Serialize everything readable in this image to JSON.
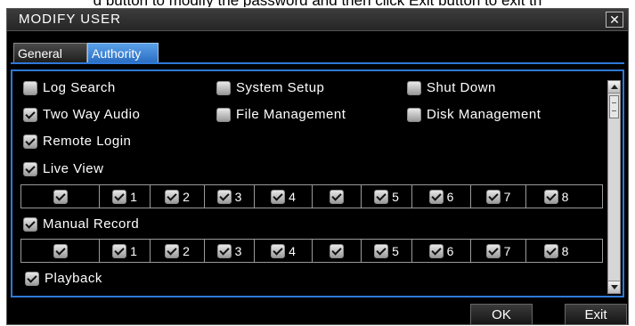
{
  "caption": "d button to modify the password and then click Exit button to exit th",
  "dialog": {
    "title": "MODIFY USER",
    "close_label": "✕",
    "tabs": [
      {
        "label": "General",
        "active": false
      },
      {
        "label": "Authority",
        "active": true
      }
    ],
    "permissions": {
      "log_search": {
        "label": "Log Search",
        "checked": false
      },
      "system_setup": {
        "label": "System Setup",
        "checked": false
      },
      "shut_down": {
        "label": "Shut Down",
        "checked": false
      },
      "two_way_audio": {
        "label": "Two Way Audio",
        "checked": true
      },
      "file_management": {
        "label": "File Management",
        "checked": false
      },
      "disk_management": {
        "label": "Disk Management",
        "checked": false
      },
      "remote_login": {
        "label": "Remote Login",
        "checked": true
      },
      "live_view": {
        "label": "Live View",
        "checked": true
      },
      "manual_record": {
        "label": "Manual Record",
        "checked": true
      },
      "playback": {
        "label": "Playback",
        "checked": true
      }
    },
    "channel_rows": {
      "live_view": [
        "",
        "1",
        "2",
        "3",
        "4",
        "",
        "5",
        "6",
        "7",
        "8"
      ],
      "manual_record": [
        "",
        "1",
        "2",
        "3",
        "4",
        "",
        "5",
        "6",
        "7",
        "8"
      ]
    },
    "buttons": {
      "ok": "OK",
      "exit": "Exit"
    }
  }
}
